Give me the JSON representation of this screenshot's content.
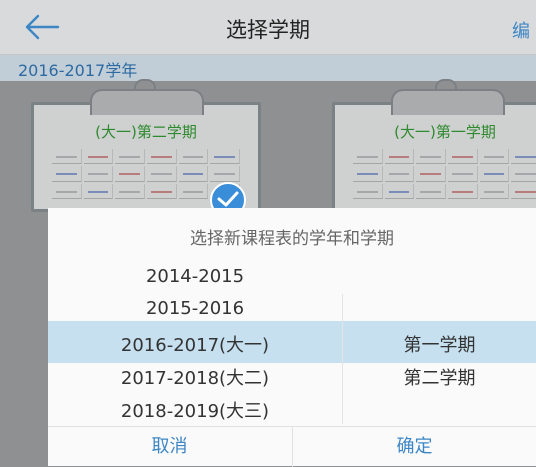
{
  "header": {
    "title": "选择学期",
    "edit_label": "编"
  },
  "year_strip": {
    "label": "2016-2017学年"
  },
  "cards": [
    {
      "title": "(大一)第二学期",
      "selected": true
    },
    {
      "title": "(大一)第一学期",
      "selected": false
    }
  ],
  "dialog": {
    "title": "选择新课程表的学年和学期",
    "years": [
      "2014-2015",
      "2015-2016",
      "2016-2017(大一)",
      "2017-2018(大二)",
      "2018-2019(大三)"
    ],
    "selected_year": "2016-2017(大一)",
    "terms": [
      "第一学期",
      "第二学期"
    ],
    "selected_term": "第一学期",
    "cancel_label": "取消",
    "confirm_label": "确定"
  },
  "colors": {
    "accent": "#3d86c6",
    "selection": "#c6e0f0",
    "card_title": "#2e8a2e"
  }
}
